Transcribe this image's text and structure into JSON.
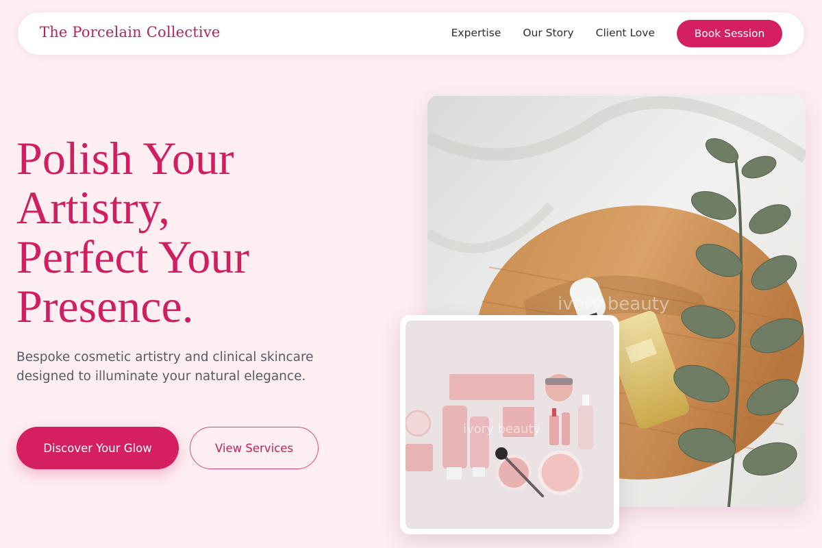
{
  "brand": {
    "name": "The Porcelain Collective"
  },
  "nav": {
    "links": [
      "Expertise",
      "Our Story",
      "Client Love"
    ],
    "cta": "Book Session"
  },
  "hero": {
    "title_lines": [
      "Polish Your",
      "Artistry,",
      "Perfect Your",
      "Presence."
    ],
    "subtitle": "Bespoke cosmetic artistry and clinical skincare designed to illuminate your natural elegance.",
    "primary_cta": "Discover Your Glow",
    "secondary_cta": "View Services"
  },
  "images": {
    "main_watermark": "ivory beauty",
    "card_watermark": "ivory beauty"
  },
  "colors": {
    "accent": "#d41f61",
    "background": "#fdeef2",
    "text": "#3a3a3a"
  }
}
